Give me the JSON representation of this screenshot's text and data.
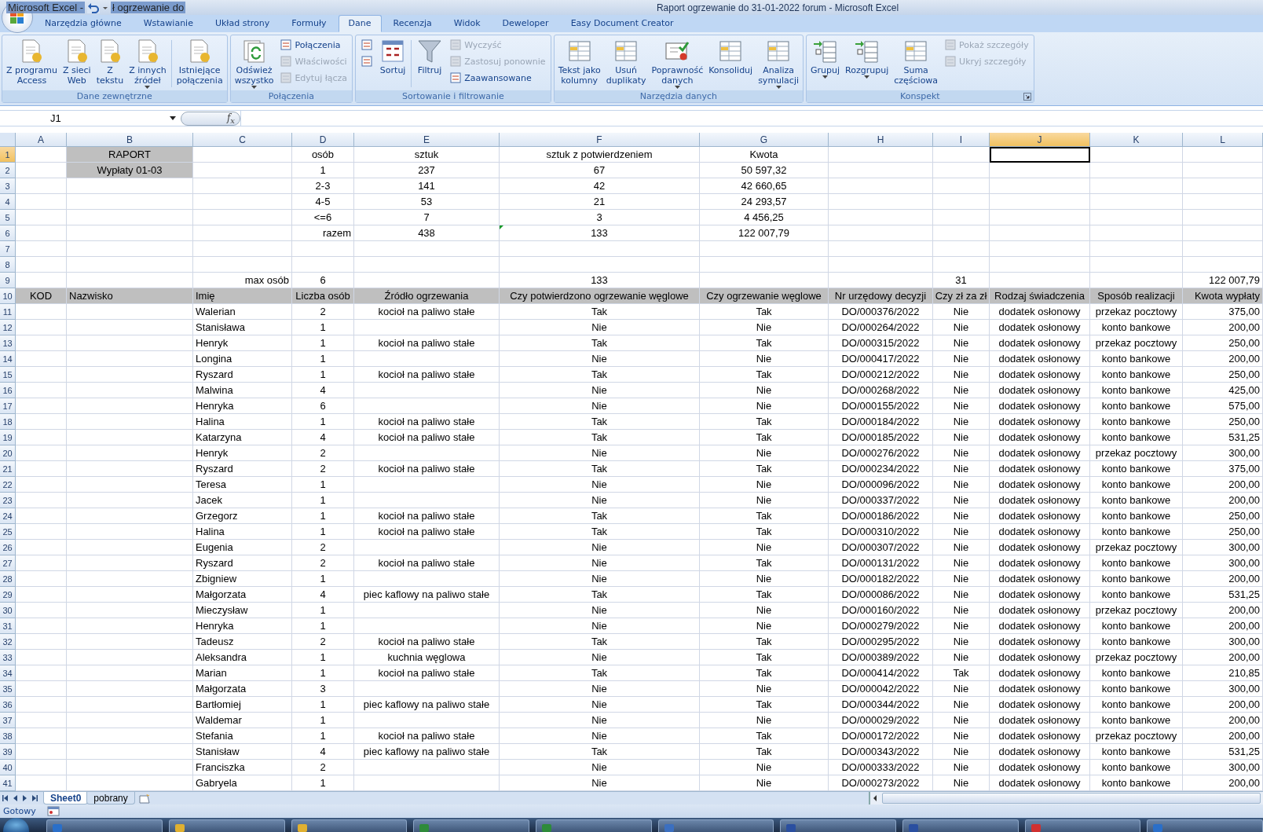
{
  "title_bar": {
    "quick_access_texts": [
      "Microsoft Excel -",
      "ł ogrzewanie do"
    ],
    "title": "Raport ogrzewanie do 31-01-2022 forum - Microsoft Excel"
  },
  "tabs": [
    {
      "label": "Narzędzia główne",
      "selected": false
    },
    {
      "label": "Wstawianie",
      "selected": false
    },
    {
      "label": "Układ strony",
      "selected": false
    },
    {
      "label": "Formuły",
      "selected": false
    },
    {
      "label": "Dane",
      "selected": true
    },
    {
      "label": "Recenzja",
      "selected": false
    },
    {
      "label": "Widok",
      "selected": false
    },
    {
      "label": "Deweloper",
      "selected": false
    },
    {
      "label": "Easy Document Creator",
      "selected": false
    }
  ],
  "ribbon_groups": [
    {
      "label": "Dane zewnętrzne",
      "launcher": false,
      "items": [
        {
          "kind": "large",
          "label": "Z programu\nAccess",
          "dropdown": false
        },
        {
          "kind": "large",
          "label": "Z sieci\nWeb",
          "dropdown": false
        },
        {
          "kind": "large",
          "label": "Z\ntekstu",
          "dropdown": false
        },
        {
          "kind": "large",
          "label": "Z innych\nźródeł",
          "dropdown": true
        },
        {
          "kind": "separator"
        },
        {
          "kind": "large",
          "label": "Istniejące\npołączenia",
          "dropdown": false
        }
      ]
    },
    {
      "label": "Połączenia",
      "launcher": false,
      "items": [
        {
          "kind": "large",
          "label": "Odśwież\nwszystko",
          "dropdown": true
        },
        {
          "kind": "stack",
          "buttons": [
            {
              "label": "Połączenia",
              "disabled": false
            },
            {
              "label": "Właściwości",
              "disabled": true
            },
            {
              "label": "Edytuj łącza",
              "disabled": true
            }
          ]
        }
      ]
    },
    {
      "label": "Sortowanie i filtrowanie",
      "launcher": false,
      "items": [
        {
          "kind": "stack",
          "buttons": [
            {
              "disabled": false
            },
            {
              "disabled": false
            }
          ]
        },
        {
          "kind": "large",
          "label": "Sortuj",
          "dropdown": false
        },
        {
          "kind": "separator"
        },
        {
          "kind": "large",
          "label": "Filtruj",
          "dropdown": false
        },
        {
          "kind": "stack",
          "buttons": [
            {
              "label": "Wyczyść",
              "disabled": true
            },
            {
              "label": "Zastosuj ponownie",
              "disabled": true
            },
            {
              "label": "Zaawansowane",
              "disabled": false
            }
          ]
        }
      ]
    },
    {
      "label": "Narzędzia danych",
      "launcher": false,
      "items": [
        {
          "kind": "large",
          "label": "Tekst jako\nkolumny",
          "dropdown": false
        },
        {
          "kind": "large",
          "label": "Usuń\nduplikaty",
          "dropdown": false
        },
        {
          "kind": "large",
          "label": "Poprawność\ndanych",
          "dropdown": true
        },
        {
          "kind": "large",
          "label": "Konsoliduj",
          "dropdown": false
        },
        {
          "kind": "large",
          "label": "Analiza\nsymulacji",
          "dropdown": true
        }
      ]
    },
    {
      "label": "Konspekt",
      "launcher": true,
      "items": [
        {
          "kind": "large",
          "label": "Grupuj",
          "dropdown": true
        },
        {
          "kind": "large",
          "label": "Rozgrupuj",
          "dropdown": true
        },
        {
          "kind": "large",
          "label": "Suma\nczęściowa",
          "dropdown": false
        },
        {
          "kind": "stack",
          "buttons": [
            {
              "label": "Pokaż szczegóły",
              "disabled": true
            },
            {
              "label": "Ukryj szczegóły",
              "disabled": true
            }
          ]
        }
      ]
    }
  ],
  "formula_bar": {
    "name_box": "J1",
    "function_symbol": "f$_{x}$"
  },
  "columns": [
    {
      "label": "A",
      "selected": false
    },
    {
      "label": "B",
      "selected": false
    },
    {
      "label": "C",
      "selected": false
    },
    {
      "label": "D",
      "selected": false
    },
    {
      "label": "E",
      "selected": false
    },
    {
      "label": "F",
      "selected": false
    },
    {
      "label": "G",
      "selected": false
    },
    {
      "label": "H",
      "selected": false
    },
    {
      "label": "I",
      "selected": false
    },
    {
      "label": "J",
      "selected": true
    },
    {
      "label": "K",
      "selected": false
    },
    {
      "label": "L",
      "selected": false
    }
  ],
  "rows": [
    {
      "number": "1",
      "selected": true,
      "cells": {
        "B": "RAPORT",
        "D": "osób",
        "E": "sztuk",
        "F": "sztuk z potwierdzeniem",
        "G": "Kwota"
      },
      "shaded": {
        "B": true
      }
    },
    {
      "number": "2",
      "selected": false,
      "cells": {
        "B": "Wypłaty 01-03",
        "D": "1",
        "E": "237",
        "F": "67",
        "G": "50 597,32"
      },
      "shaded": {
        "B": true
      }
    },
    {
      "number": "3",
      "selected": false,
      "cells": {
        "D": "2-3",
        "E": "141",
        "F": "42",
        "G": "42 660,65"
      }
    },
    {
      "number": "4",
      "selected": false,
      "cells": {
        "D": "4-5",
        "E": "53",
        "F": "21",
        "G": "24 293,57"
      }
    },
    {
      "number": "5",
      "selected": false,
      "cells": {
        "D": "<=6",
        "E": "7",
        "F": "3",
        "G": "4 456,25"
      }
    },
    {
      "number": "6",
      "selected": false,
      "cells": {
        "D": "razem",
        "E": "438",
        "F": "133",
        "G": "122 007,79"
      },
      "flagged": {
        "F": true
      }
    },
    {
      "number": "7",
      "selected": false,
      "cells": {}
    },
    {
      "number": "8",
      "selected": false,
      "cells": {}
    },
    {
      "number": "9",
      "selected": false,
      "cells": {
        "C": "max osób",
        "D": "6",
        "F": "133",
        "I": "31",
        "L": "122 007,79"
      }
    },
    {
      "number": "10",
      "selected": false,
      "cells": {
        "A": "KOD",
        "B": "Nazwisko",
        "C": "Imię",
        "D": "Liczba osób",
        "E": "Źródło ogrzewania",
        "F": "Czy potwierdzono ogrzewanie węglowe",
        "G": "Czy ogrzewanie węglowe",
        "H": "Nr urzędowy decyzji",
        "I": "Czy zł za zł",
        "J": "Rodzaj świadczenia",
        "K": "Sposób realizacji",
        "L": "Kwota wypłaty"
      },
      "shaded": {
        "A": true,
        "B": true,
        "C": true,
        "D": true,
        "E": true,
        "F": true,
        "G": true,
        "H": true,
        "I": true,
        "J": true,
        "K": true,
        "L": true
      }
    },
    {
      "number": "11",
      "selected": false,
      "cells": {
        "C": "Walerian",
        "D": "2",
        "E": "kocioł na paliwo stałe",
        "F": "Tak",
        "G": "Tak",
        "H": "DO/000376/2022",
        "I": "Nie",
        "J": "dodatek osłonowy",
        "K": "przekaz pocztowy",
        "L": "375,00"
      }
    },
    {
      "number": "12",
      "selected": false,
      "cells": {
        "C": "Stanisława",
        "D": "1",
        "F": "Nie",
        "G": "Nie",
        "H": "DO/000264/2022",
        "I": "Nie",
        "J": "dodatek osłonowy",
        "K": "konto bankowe",
        "L": "200,00"
      }
    },
    {
      "number": "13",
      "selected": false,
      "cells": {
        "C": "Henryk",
        "D": "1",
        "E": "kocioł na paliwo stałe",
        "F": "Tak",
        "G": "Tak",
        "H": "DO/000315/2022",
        "I": "Nie",
        "J": "dodatek osłonowy",
        "K": "przekaz pocztowy",
        "L": "250,00"
      }
    },
    {
      "number": "14",
      "selected": false,
      "cells": {
        "C": "Longina",
        "D": "1",
        "F": "Nie",
        "G": "Nie",
        "H": "DO/000417/2022",
        "I": "Nie",
        "J": "dodatek osłonowy",
        "K": "konto bankowe",
        "L": "200,00"
      }
    },
    {
      "number": "15",
      "selected": false,
      "cells": {
        "C": "Ryszard",
        "D": "1",
        "E": "kocioł na paliwo stałe",
        "F": "Tak",
        "G": "Tak",
        "H": "DO/000212/2022",
        "I": "Nie",
        "J": "dodatek osłonowy",
        "K": "konto bankowe",
        "L": "250,00"
      }
    },
    {
      "number": "16",
      "selected": false,
      "cells": {
        "C": "Malwina",
        "D": "4",
        "F": "Nie",
        "G": "Nie",
        "H": "DO/000268/2022",
        "I": "Nie",
        "J": "dodatek osłonowy",
        "K": "konto bankowe",
        "L": "425,00"
      }
    },
    {
      "number": "17",
      "selected": false,
      "cells": {
        "C": "Henryka",
        "D": "6",
        "F": "Nie",
        "G": "Nie",
        "H": "DO/000155/2022",
        "I": "Nie",
        "J": "dodatek osłonowy",
        "K": "konto bankowe",
        "L": "575,00"
      }
    },
    {
      "number": "18",
      "selected": false,
      "cells": {
        "C": "Halina",
        "D": "1",
        "E": "kocioł na paliwo stałe",
        "F": "Tak",
        "G": "Tak",
        "H": "DO/000184/2022",
        "I": "Nie",
        "J": "dodatek osłonowy",
        "K": "konto bankowe",
        "L": "250,00"
      }
    },
    {
      "number": "19",
      "selected": false,
      "cells": {
        "C": "Katarzyna",
        "D": "4",
        "E": "kocioł na paliwo stałe",
        "F": "Tak",
        "G": "Tak",
        "H": "DO/000185/2022",
        "I": "Nie",
        "J": "dodatek osłonowy",
        "K": "konto bankowe",
        "L": "531,25"
      }
    },
    {
      "number": "20",
      "selected": false,
      "cells": {
        "C": "Henryk",
        "D": "2",
        "F": "Nie",
        "G": "Nie",
        "H": "DO/000276/2022",
        "I": "Nie",
        "J": "dodatek osłonowy",
        "K": "przekaz pocztowy",
        "L": "300,00"
      }
    },
    {
      "number": "21",
      "selected": false,
      "cells": {
        "C": "Ryszard",
        "D": "2",
        "E": "kocioł na paliwo stałe",
        "F": "Tak",
        "G": "Tak",
        "H": "DO/000234/2022",
        "I": "Nie",
        "J": "dodatek osłonowy",
        "K": "konto bankowe",
        "L": "375,00"
      }
    },
    {
      "number": "22",
      "selected": false,
      "cells": {
        "C": "Teresa",
        "D": "1",
        "F": "Nie",
        "G": "Nie",
        "H": "DO/000096/2022",
        "I": "Nie",
        "J": "dodatek osłonowy",
        "K": "konto bankowe",
        "L": "200,00"
      }
    },
    {
      "number": "23",
      "selected": false,
      "cells": {
        "C": "Jacek",
        "D": "1",
        "F": "Nie",
        "G": "Nie",
        "H": "DO/000337/2022",
        "I": "Nie",
        "J": "dodatek osłonowy",
        "K": "konto bankowe",
        "L": "200,00"
      }
    },
    {
      "number": "24",
      "selected": false,
      "cells": {
        "C": "Grzegorz",
        "D": "1",
        "E": "kocioł na paliwo stałe",
        "F": "Tak",
        "G": "Tak",
        "H": "DO/000186/2022",
        "I": "Nie",
        "J": "dodatek osłonowy",
        "K": "konto bankowe",
        "L": "250,00"
      }
    },
    {
      "number": "25",
      "selected": false,
      "cells": {
        "C": "Halina",
        "D": "1",
        "E": "kocioł na paliwo stałe",
        "F": "Tak",
        "G": "Tak",
        "H": "DO/000310/2022",
        "I": "Nie",
        "J": "dodatek osłonowy",
        "K": "konto bankowe",
        "L": "250,00"
      }
    },
    {
      "number": "26",
      "selected": false,
      "cells": {
        "C": "Eugenia",
        "D": "2",
        "F": "Nie",
        "G": "Nie",
        "H": "DO/000307/2022",
        "I": "Nie",
        "J": "dodatek osłonowy",
        "K": "przekaz pocztowy",
        "L": "300,00"
      }
    },
    {
      "number": "27",
      "selected": false,
      "cells": {
        "C": "Ryszard",
        "D": "2",
        "E": "kocioł na paliwo stałe",
        "F": "Nie",
        "G": "Tak",
        "H": "DO/000131/2022",
        "I": "Nie",
        "J": "dodatek osłonowy",
        "K": "konto bankowe",
        "L": "300,00"
      }
    },
    {
      "number": "28",
      "selected": false,
      "cells": {
        "C": "Zbigniew",
        "D": "1",
        "F": "Nie",
        "G": "Nie",
        "H": "DO/000182/2022",
        "I": "Nie",
        "J": "dodatek osłonowy",
        "K": "konto bankowe",
        "L": "200,00"
      }
    },
    {
      "number": "29",
      "selected": false,
      "cells": {
        "C": "Małgorzata",
        "D": "4",
        "E": "piec kaflowy na paliwo stałe",
        "F": "Tak",
        "G": "Tak",
        "H": "DO/000086/2022",
        "I": "Nie",
        "J": "dodatek osłonowy",
        "K": "konto bankowe",
        "L": "531,25"
      }
    },
    {
      "number": "30",
      "selected": false,
      "cells": {
        "C": "Mieczysław",
        "D": "1",
        "F": "Nie",
        "G": "Nie",
        "H": "DO/000160/2022",
        "I": "Nie",
        "J": "dodatek osłonowy",
        "K": "przekaz pocztowy",
        "L": "200,00"
      }
    },
    {
      "number": "31",
      "selected": false,
      "cells": {
        "C": "Henryka",
        "D": "1",
        "F": "Nie",
        "G": "Nie",
        "H": "DO/000279/2022",
        "I": "Nie",
        "J": "dodatek osłonowy",
        "K": "konto bankowe",
        "L": "200,00"
      }
    },
    {
      "number": "32",
      "selected": false,
      "cells": {
        "C": "Tadeusz",
        "D": "2",
        "E": "kocioł na paliwo stałe",
        "F": "Tak",
        "G": "Tak",
        "H": "DO/000295/2022",
        "I": "Nie",
        "J": "dodatek osłonowy",
        "K": "konto bankowe",
        "L": "300,00"
      }
    },
    {
      "number": "33",
      "selected": false,
      "cells": {
        "C": "Aleksandra",
        "D": "1",
        "E": "kuchnia węglowa",
        "F": "Nie",
        "G": "Tak",
        "H": "DO/000389/2022",
        "I": "Nie",
        "J": "dodatek osłonowy",
        "K": "przekaz pocztowy",
        "L": "200,00"
      }
    },
    {
      "number": "34",
      "selected": false,
      "cells": {
        "C": "Marian",
        "D": "1",
        "E": "kocioł na paliwo stałe",
        "F": "Tak",
        "G": "Tak",
        "H": "DO/000414/2022",
        "I": "Tak",
        "J": "dodatek osłonowy",
        "K": "konto bankowe",
        "L": "210,85"
      }
    },
    {
      "number": "35",
      "selected": false,
      "cells": {
        "C": "Małgorzata",
        "D": "3",
        "F": "Nie",
        "G": "Nie",
        "H": "DO/000042/2022",
        "I": "Nie",
        "J": "dodatek osłonowy",
        "K": "konto bankowe",
        "L": "300,00"
      }
    },
    {
      "number": "36",
      "selected": false,
      "cells": {
        "C": "Bartłomiej",
        "D": "1",
        "E": "piec kaflowy na paliwo stałe",
        "F": "Nie",
        "G": "Tak",
        "H": "DO/000344/2022",
        "I": "Nie",
        "J": "dodatek osłonowy",
        "K": "konto bankowe",
        "L": "200,00"
      }
    },
    {
      "number": "37",
      "selected": false,
      "cells": {
        "C": "Waldemar",
        "D": "1",
        "F": "Nie",
        "G": "Nie",
        "H": "DO/000029/2022",
        "I": "Nie",
        "J": "dodatek osłonowy",
        "K": "konto bankowe",
        "L": "200,00"
      }
    },
    {
      "number": "38",
      "selected": false,
      "cells": {
        "C": "Stefania",
        "D": "1",
        "E": "kocioł na paliwo stałe",
        "F": "Nie",
        "G": "Tak",
        "H": "DO/000172/2022",
        "I": "Nie",
        "J": "dodatek osłonowy",
        "K": "przekaz pocztowy",
        "L": "200,00"
      }
    },
    {
      "number": "39",
      "selected": false,
      "cells": {
        "C": "Stanisław",
        "D": "4",
        "E": "piec kaflowy na paliwo stałe",
        "F": "Tak",
        "G": "Tak",
        "H": "DO/000343/2022",
        "I": "Nie",
        "J": "dodatek osłonowy",
        "K": "konto bankowe",
        "L": "531,25"
      }
    },
    {
      "number": "40",
      "selected": false,
      "cells": {
        "C": "Franciszka",
        "D": "2",
        "F": "Nie",
        "G": "Nie",
        "H": "DO/000333/2022",
        "I": "Nie",
        "J": "dodatek osłonowy",
        "K": "konto bankowe",
        "L": "300,00"
      }
    },
    {
      "number": "41",
      "selected": false,
      "cells": {
        "C": "Gabryela",
        "D": "1",
        "F": "Nie",
        "G": "Nie",
        "H": "DO/000273/2022",
        "I": "Nie",
        "J": "dodatek osłonowy",
        "K": "konto bankowe",
        "L": "200,00"
      }
    }
  ],
  "sheet_tabs": [
    {
      "label": "Sheet0",
      "selected": true
    },
    {
      "label": "pobrany",
      "selected": false
    }
  ],
  "status_bar": {
    "text": "Gotowy"
  }
}
